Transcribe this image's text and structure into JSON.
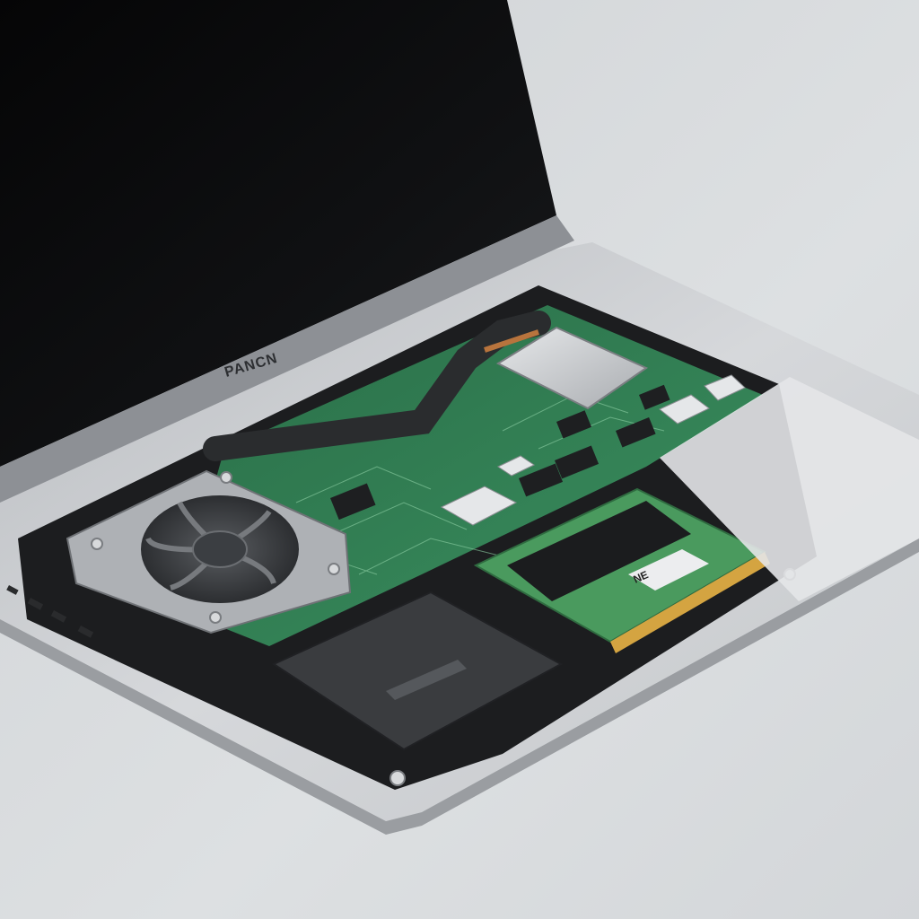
{
  "scene": {
    "description_visible_text": {
      "bezel_brand": "PANCN",
      "ram_label": "NE"
    },
    "colors": {
      "background": "#d9dbdd",
      "chassis": "#c7cacd",
      "screen": "#0b0c0d",
      "pcb": "#2f7d52",
      "heat_pipe": "#2a2c2e",
      "copper": "#b8743d",
      "ssd": "#3a3c3f"
    },
    "icons": [
      "cooling-fan-icon",
      "heat-pipe",
      "cpu-heat-spreader",
      "ram-module",
      "ssd-module"
    ]
  }
}
